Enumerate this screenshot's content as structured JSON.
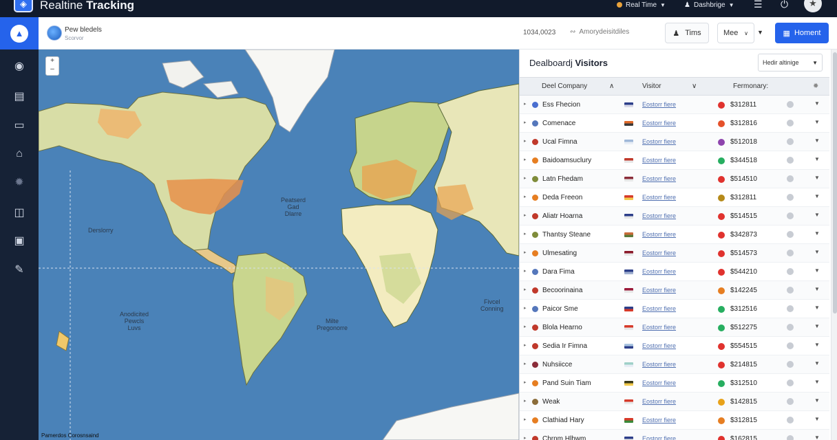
{
  "app": {
    "title_light": "Realtine ",
    "title_bold": "Tracking"
  },
  "topbar": {
    "realtime_label": "Real Time",
    "user_label": "Dashbrige",
    "menu_icon": "hamburger-icon",
    "power_icon": "power-icon",
    "star_icon": "star-icon"
  },
  "sidebar": {
    "items": [
      {
        "name": "sidebar-item-home-active",
        "icon": "rocket-icon"
      },
      {
        "name": "sidebar-item-globe",
        "icon": "globe-icon"
      },
      {
        "name": "sidebar-item-briefcase",
        "icon": "briefcase-icon"
      },
      {
        "name": "sidebar-item-monitor",
        "icon": "monitor-icon"
      },
      {
        "name": "sidebar-item-house",
        "icon": "house-icon"
      },
      {
        "name": "sidebar-item-settings",
        "icon": "gear-icon"
      },
      {
        "name": "sidebar-item-books",
        "icon": "book-icon"
      },
      {
        "name": "sidebar-item-storage",
        "icon": "storage-icon"
      },
      {
        "name": "sidebar-item-tools",
        "icon": "wrench-icon"
      }
    ]
  },
  "header": {
    "title": "Pew bledels",
    "subtitle": "Scorvor",
    "count": "1034,0023",
    "analytics": "Amorydeisitdiles",
    "time_button": "Tims",
    "select_value": "Mee",
    "primary_button": "Homent"
  },
  "map": {
    "labels": [
      {
        "text": "Derslorry"
      },
      {
        "text": "Peatserd\nGad\nDlarre"
      },
      {
        "text": "Anodicited\nPewcls\nLuvs"
      },
      {
        "text": "Milte\nPregonorre"
      },
      {
        "text": "Fivcel\nConning"
      }
    ],
    "zoom": "+\n–",
    "attribution": "Pamerdos Corosnsaind"
  },
  "panel": {
    "title_regular": "Dealboardj ",
    "title_bold": "Visitors",
    "filter_value": "Hedir altinige",
    "columns": {
      "company": "Deel Company",
      "visitor": "Visitor",
      "summary": "Fermonary:"
    },
    "colors": {
      "accent": "#2563eb",
      "link": "#4f6fb0"
    },
    "rows": [
      {
        "name": "Ess Fhecion",
        "link": "Eostorr fiere",
        "amount": "$312811",
        "dot": "#4a6fd0",
        "flag": [
          "#2d3f8a",
          "#d9d9e8"
        ],
        "sdot": "#e0322e"
      },
      {
        "name": "Comenace",
        "link": "Eostorr fiere",
        "amount": "$312816",
        "dot": "#5577bb",
        "flag": [
          "#e06a2b",
          "#3a3a3a"
        ],
        "sdot": "#e5512a"
      },
      {
        "name": "Ucal Fimna",
        "link": "Eostorr fiere",
        "amount": "$512018",
        "dot": "#c0392b",
        "flag": [
          "#9fb8d8",
          "#e8eef6"
        ],
        "sdot": "#8e44ad"
      },
      {
        "name": "Baidoamsuclury",
        "link": "Eostorr fiere",
        "amount": "$344518",
        "dot": "#e67e22",
        "flag": [
          "#c0392b",
          "#e8e8e8"
        ],
        "sdot": "#27ae60"
      },
      {
        "name": "Latn Fhedam",
        "link": "Eostorr fiere",
        "amount": "$514510",
        "dot": "#7f8c3a",
        "flag": [
          "#8b2d3a",
          "#e8e8e8"
        ],
        "sdot": "#e0322e"
      },
      {
        "name": "Deda Freeon",
        "link": "Eostorr fiere",
        "amount": "$312811",
        "dot": "#e67e22",
        "flag": [
          "#d63a2a",
          "#f2c94c"
        ],
        "sdot": "#b58a1a"
      },
      {
        "name": "Aliatr Hoarna",
        "link": "Eostorr fiere",
        "amount": "$514515",
        "dot": "#c0392b",
        "flag": [
          "#2d3f8a",
          "#e8e8e8"
        ],
        "sdot": "#e0322e"
      },
      {
        "name": "Thantsy Steane",
        "link": "Eostorr fiere",
        "amount": "$342873",
        "dot": "#7f8c3a",
        "flag": [
          "#c96b3a",
          "#5a7a3a"
        ],
        "sdot": "#e0322e"
      },
      {
        "name": "Ulmesating",
        "link": "Eostorr fiere",
        "amount": "$514573",
        "dot": "#e67e22",
        "flag": [
          "#8b1a2a",
          "#e8e8e8"
        ],
        "sdot": "#e0322e"
      },
      {
        "name": "Dara Fima",
        "link": "Eostorr fiere",
        "amount": "$544210",
        "dot": "#5577bb",
        "flag": [
          "#2d3f8a",
          "#a0b0d0"
        ],
        "sdot": "#e0322e"
      },
      {
        "name": "Becoorinaina",
        "link": "Eostorr fiere",
        "amount": "$142245",
        "dot": "#c0392b",
        "flag": [
          "#9b1a3a",
          "#e8e8e8"
        ],
        "sdot": "#e67e22"
      },
      {
        "name": "Paicor Sme",
        "link": "Eostorr fiere",
        "amount": "$312516",
        "dot": "#5577bb",
        "flag": [
          "#2d3f8a",
          "#d63a2a"
        ],
        "sdot": "#27ae60"
      },
      {
        "name": "Blola Hearno",
        "link": "Eostorr fiere",
        "amount": "$512275",
        "dot": "#c0392b",
        "flag": [
          "#d63a2a",
          "#e8e8e8"
        ],
        "sdot": "#27ae60"
      },
      {
        "name": "Sedia Ir Fimna",
        "link": "Eostorr fiere",
        "amount": "$554515",
        "dot": "#c0392b",
        "flag": [
          "#a9c4e0",
          "#2d3f8a"
        ],
        "sdot": "#e0322e"
      },
      {
        "name": "Nuhsiicce",
        "link": "Eostorr fiere",
        "amount": "$214815",
        "dot": "#8b2d3a",
        "flag": [
          "#9fd0c8",
          "#e8eef6"
        ],
        "sdot": "#e0322e"
      },
      {
        "name": "Pand Suin Tiam",
        "link": "Eostorr fiere",
        "amount": "$312510",
        "dot": "#e67e22",
        "flag": [
          "#3a3a1a",
          "#f2c94c"
        ],
        "sdot": "#27ae60"
      },
      {
        "name": "Weak",
        "link": "Eostorr fiere",
        "amount": "$142815",
        "dot": "#8b6d3a",
        "flag": [
          "#d63a2a",
          "#e8e8e8"
        ],
        "sdot": "#e8a21a"
      },
      {
        "name": "Clathiad Hary",
        "link": "Eostorr fiere",
        "amount": "$312815",
        "dot": "#e67e22",
        "flag": [
          "#d63a2a",
          "#3a8a3a"
        ],
        "sdot": "#e67e22"
      },
      {
        "name": "Chrnm Hlhwm",
        "link": "Eostorr fiere",
        "amount": "$162815",
        "dot": "#c0392b",
        "flag": [
          "#2d3f8a",
          "#e8e8e8"
        ],
        "sdot": "#e0322e"
      }
    ]
  }
}
